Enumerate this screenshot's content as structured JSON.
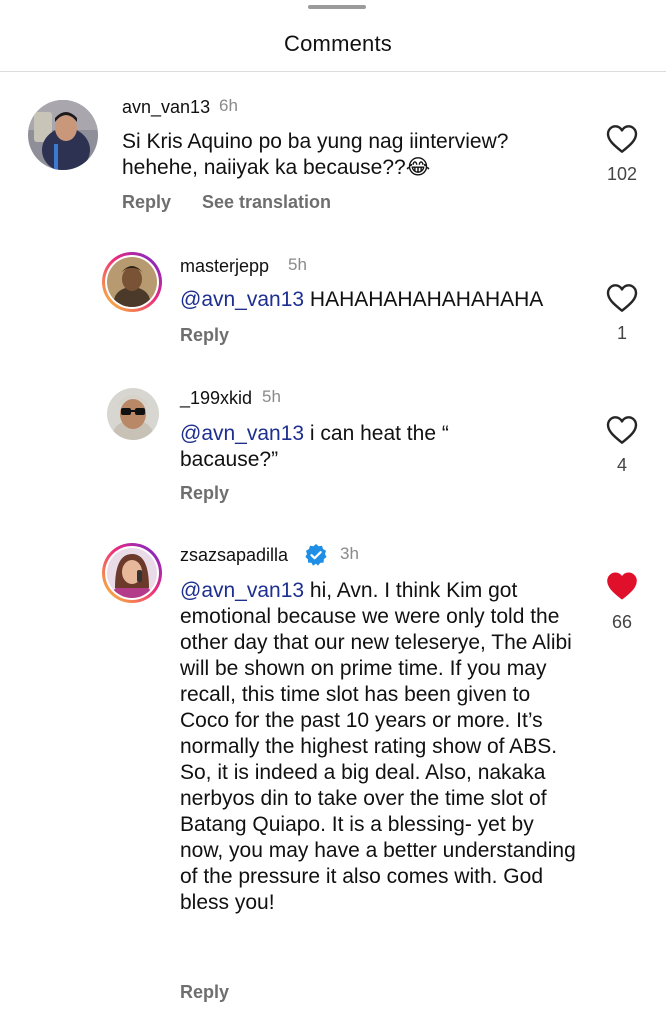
{
  "header": {
    "title": "Comments"
  },
  "comments": [
    {
      "username": "avn_van13",
      "time": "6h",
      "text": "Si Kris Aquino po ba yung nag iinterview? hehehe, naiiyak ka because??😂",
      "likes": "102",
      "liked": false,
      "reply_label": "Reply",
      "translate_label": "See translation"
    },
    {
      "username": "masterjepp",
      "time": "5h",
      "mention": "@avn_van13",
      "text": " HAHAHAHAHAHAHAHA",
      "likes": "1",
      "liked": false,
      "reply_label": "Reply"
    },
    {
      "username": "_199xkid",
      "time": "5h",
      "mention": "@avn_van13",
      "text": " i can heat the “ bacause?”",
      "likes": "4",
      "liked": false,
      "reply_label": "Reply"
    },
    {
      "username": "zsazsapadilla",
      "time": "3h",
      "verified": true,
      "mention": "@avn_van13",
      "text": " hi, Avn. I think Kim got emotional because we were only told the other day that our new teleserye, The Alibi will be shown on prime time. If you may recall, this time slot has been given to Coco for the past 10 years or more. It’s normally the highest rating show of ABS. So, it is indeed a big deal. Also, nakaka nerbyos din to take over the time slot of Batang Quiapo. It is a blessing- yet by now, you may have a better understanding of the pressure it also comes with. God bless you!",
      "likes": "66",
      "liked": true,
      "reply_label": "Reply"
    }
  ],
  "colors": {
    "mention": "#1d2f8f",
    "liked_heart": "#e0102b",
    "muted": "#6e6e6e"
  }
}
